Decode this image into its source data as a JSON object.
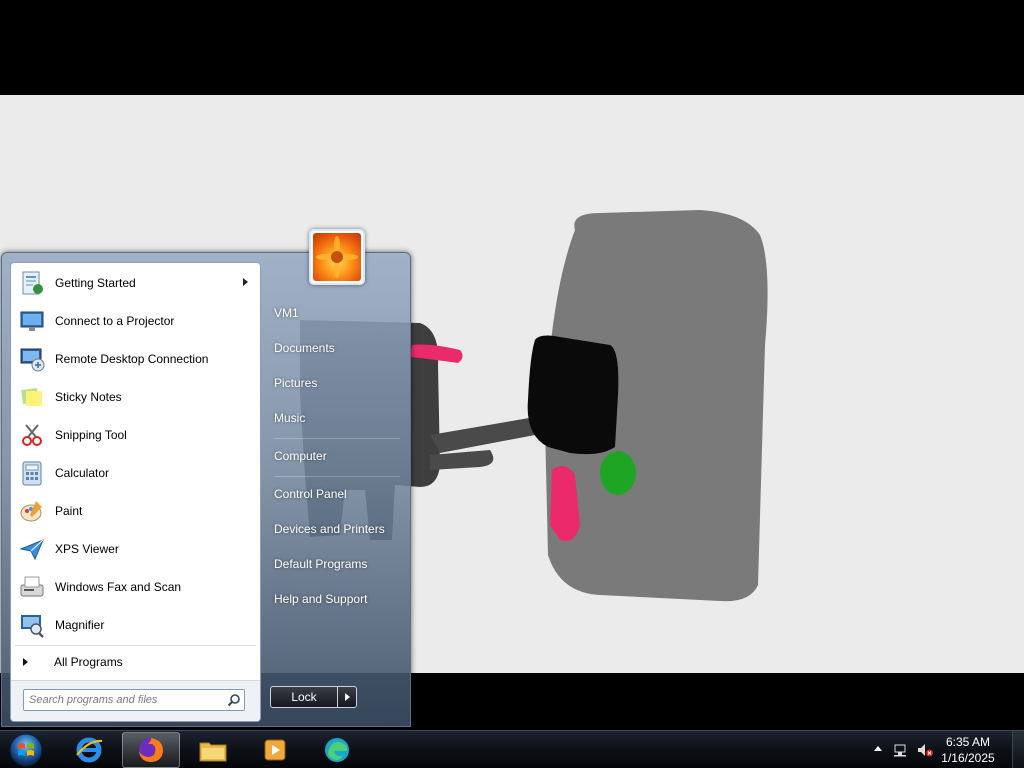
{
  "start_menu": {
    "programs": [
      {
        "label": "Getting Started",
        "icon": "getting-started-icon",
        "has_submenu": true
      },
      {
        "label": "Connect to a Projector",
        "icon": "projector-icon"
      },
      {
        "label": "Remote Desktop Connection",
        "icon": "remote-desktop-icon"
      },
      {
        "label": "Sticky Notes",
        "icon": "sticky-notes-icon"
      },
      {
        "label": "Snipping Tool",
        "icon": "snipping-tool-icon"
      },
      {
        "label": "Calculator",
        "icon": "calculator-icon"
      },
      {
        "label": "Paint",
        "icon": "paint-icon"
      },
      {
        "label": "XPS Viewer",
        "icon": "xps-viewer-icon"
      },
      {
        "label": "Windows Fax and Scan",
        "icon": "fax-scan-icon"
      },
      {
        "label": "Magnifier",
        "icon": "magnifier-icon"
      }
    ],
    "all_programs_label": "All Programs",
    "search_placeholder": "Search programs and files",
    "user_name": "VM1",
    "right_links": [
      {
        "label": "Documents"
      },
      {
        "label": "Pictures"
      },
      {
        "label": "Music"
      },
      {
        "label": "Computer"
      },
      {
        "label": "Control Panel"
      },
      {
        "label": "Devices and Printers"
      },
      {
        "label": "Default Programs"
      },
      {
        "label": "Help and Support"
      }
    ],
    "lock_label": "Lock"
  },
  "taskbar": {
    "pinned": [
      {
        "icon": "internet-explorer-icon",
        "active": false
      },
      {
        "icon": "firefox-icon",
        "active": true
      },
      {
        "icon": "file-explorer-icon",
        "active": false
      },
      {
        "icon": "media-player-icon",
        "active": false
      },
      {
        "icon": "edge-icon",
        "active": false
      }
    ],
    "clock_time": "6:35 AM",
    "clock_date": "1/16/2025"
  },
  "colors": {
    "canvas_bg": "#ebebeb",
    "drawing_gray": "#7a7a7a",
    "drawing_dark": "#3e3e3e",
    "drawing_black": "#0a0a0a",
    "drawing_pink": "#ea2a6a",
    "drawing_green": "#1fa524"
  }
}
